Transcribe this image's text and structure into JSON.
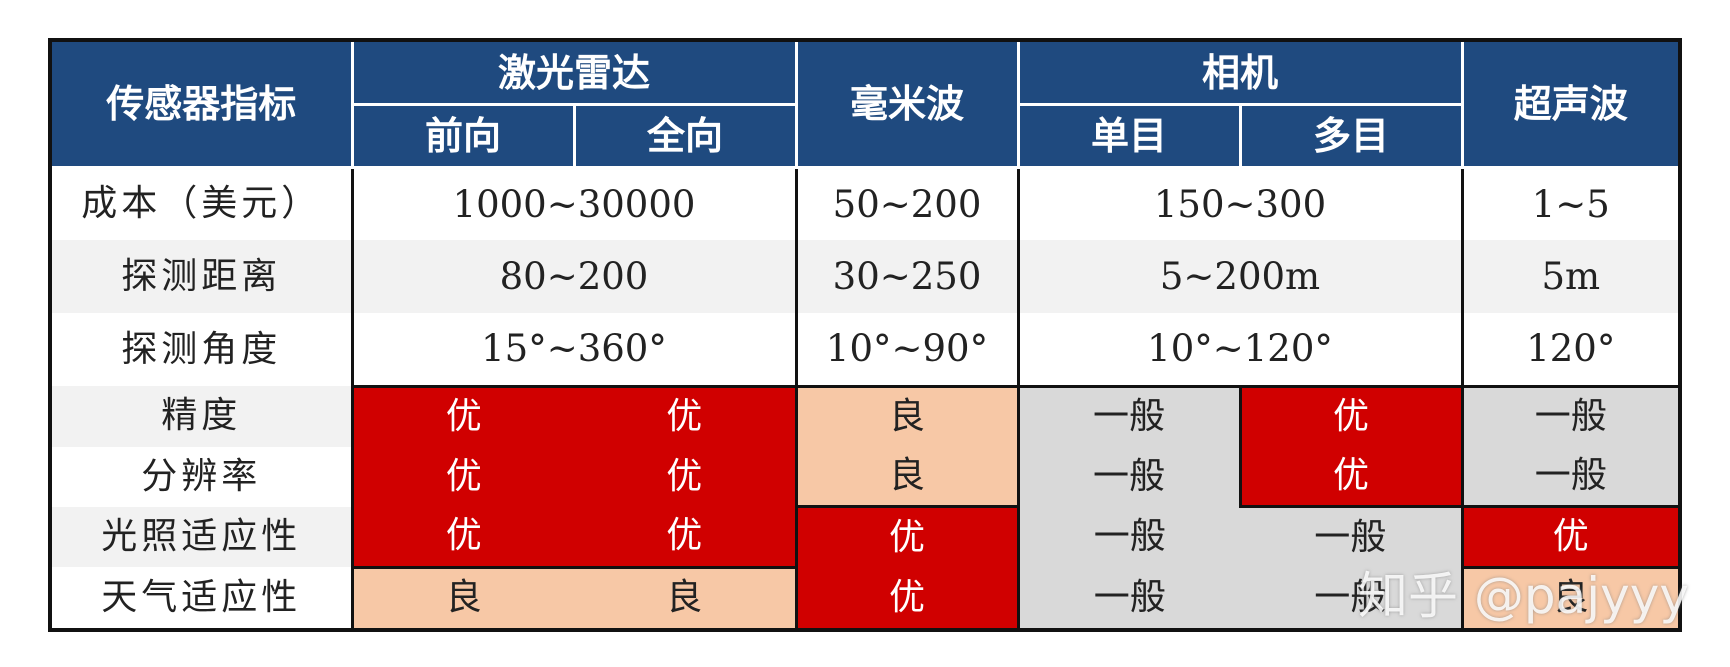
{
  "header": {
    "row_label": "传感器指标",
    "lidar": {
      "label": "激光雷达",
      "sub": [
        "前向",
        "全向"
      ]
    },
    "mmwave": {
      "label": "毫米波"
    },
    "camera": {
      "label": "相机",
      "sub": [
        "单目",
        "多目"
      ]
    },
    "ultrasonic": {
      "label": "超声波"
    }
  },
  "rows": {
    "cost": {
      "label": "成本（美元）",
      "lidar": "1000~30000",
      "mmwave": "50~200",
      "camera": "150~300",
      "ultrasonic": "1~5"
    },
    "range": {
      "label": "探测距离",
      "lidar": "80~200",
      "mmwave": "30~250",
      "camera": "5~200m",
      "ultrasonic": "5m"
    },
    "angle": {
      "label": "探测角度",
      "lidar": "15°~360°",
      "mmwave": "10°~90°",
      "camera": "10°~120°",
      "ultrasonic": "120°"
    },
    "precision": {
      "label": "精度",
      "lidar_front": "优",
      "lidar_full": "优",
      "mmwave": "良",
      "camera_mono": "一般",
      "camera_multi": "优",
      "ultrasonic": "一般"
    },
    "resolution": {
      "label": "分辨率",
      "lidar_front": "优",
      "lidar_full": "优",
      "mmwave": "良",
      "camera_mono": "一般",
      "camera_multi": "优",
      "ultrasonic": "一般"
    },
    "light": {
      "label": "光照适应性",
      "lidar_front": "优",
      "lidar_full": "优",
      "mmwave": "优",
      "camera_mono": "一般",
      "camera_multi": "一般",
      "ultrasonic": "优"
    },
    "weather": {
      "label": "天气适应性",
      "lidar_front": "良",
      "lidar_full": "良",
      "mmwave": "优",
      "camera_mono": "一般",
      "camera_multi": "一般",
      "ultrasonic": "良"
    }
  },
  "colors": {
    "header_bg": "#1f4a7f",
    "rating_excellent": "#d00000",
    "rating_good": "#f7c8a6",
    "rating_average": "#d9d9d9"
  },
  "watermark": "知乎 @pajyyy"
}
